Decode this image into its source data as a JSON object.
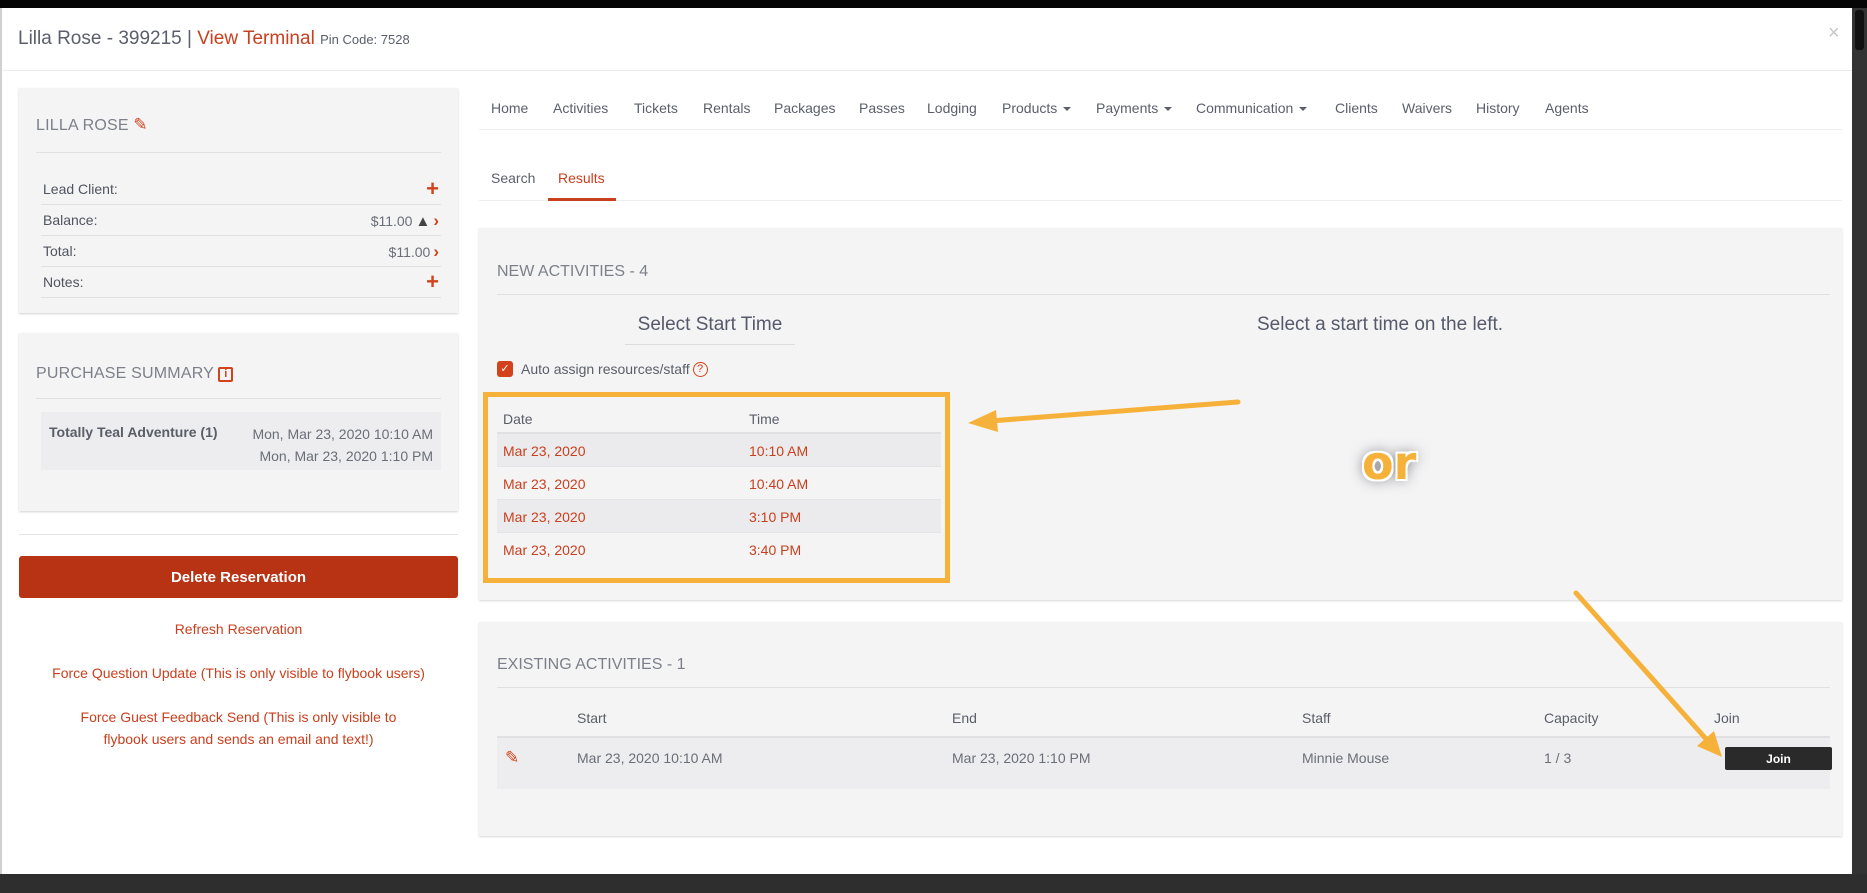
{
  "header": {
    "client_name_id": "Lilla Rose - 399215",
    "separator": "|",
    "view_terminal": "View Terminal",
    "pin_code": "Pin Code: 7528",
    "close_icon": "×"
  },
  "client_card": {
    "name": "LILLA ROSE",
    "rows": [
      {
        "label": "Lead Client:",
        "value": "",
        "action": "plus"
      },
      {
        "label": "Balance:",
        "value": "$11.00",
        "action": "warning-chevron"
      },
      {
        "label": "Total:",
        "value": "$11.00",
        "action": "chevron"
      },
      {
        "label": "Notes:",
        "value": "",
        "action": "plus"
      }
    ]
  },
  "purchase_summary": {
    "title": "PURCHASE SUMMARY",
    "item_name": "Totally Teal Adventure (1)",
    "start": "Mon, Mar 23, 2020 10:10 AM",
    "end": "Mon, Mar 23, 2020 1:10 PM"
  },
  "actions": {
    "delete": "Delete Reservation",
    "refresh": "Refresh Reservation",
    "force_question": "Force Question Update (This is only visible to flybook users)",
    "force_feedback": "Force Guest Feedback Send (This is only visible to flybook users and sends an email and text!)"
  },
  "nav": {
    "items": [
      {
        "label": "Home",
        "dropdown": false
      },
      {
        "label": "Activities",
        "dropdown": false
      },
      {
        "label": "Tickets",
        "dropdown": false
      },
      {
        "label": "Rentals",
        "dropdown": false
      },
      {
        "label": "Packages",
        "dropdown": false
      },
      {
        "label": "Passes",
        "dropdown": false
      },
      {
        "label": "Lodging",
        "dropdown": false
      },
      {
        "label": "Products",
        "dropdown": true
      },
      {
        "label": "Payments",
        "dropdown": true
      },
      {
        "label": "Communication",
        "dropdown": true
      },
      {
        "label": "Clients",
        "dropdown": false
      },
      {
        "label": "Waivers",
        "dropdown": false
      },
      {
        "label": "History",
        "dropdown": false
      },
      {
        "label": "Agents",
        "dropdown": false
      }
    ]
  },
  "subtabs": {
    "items": [
      {
        "label": "Search",
        "active": false
      },
      {
        "label": "Results",
        "active": true
      }
    ]
  },
  "new_activities": {
    "title": "NEW ACTIVITIES - 4",
    "select_start_heading": "Select Start Time",
    "right_prompt": "Select a start time on the left.",
    "auto_assign_label": "Auto assign resources/staff",
    "auto_assign_checked": true,
    "columns": [
      "Date",
      "Time"
    ],
    "rows": [
      {
        "date": "Mar 23, 2020",
        "time": "10:10 AM"
      },
      {
        "date": "Mar 23, 2020",
        "time": "10:40 AM"
      },
      {
        "date": "Mar 23, 2020",
        "time": "3:10 PM"
      },
      {
        "date": "Mar 23, 2020",
        "time": "3:40 PM"
      }
    ]
  },
  "existing_activities": {
    "title": "EXISTING ACTIVITIES - 1",
    "columns": [
      "",
      "Start",
      "End",
      "Staff",
      "Capacity",
      "Join"
    ],
    "rows": [
      {
        "start": "Mar 23, 2020 10:10 AM",
        "end": "Mar 23, 2020 1:10 PM",
        "staff": "Minnie Mouse",
        "capacity": "1 / 3",
        "join_label": "Join"
      }
    ]
  },
  "annotation": {
    "or_text": "or",
    "color": "#f6b13a"
  },
  "colors": {
    "accent": "#c8401f",
    "delete_button": "#b83214",
    "join_button": "#2a2a2a"
  }
}
